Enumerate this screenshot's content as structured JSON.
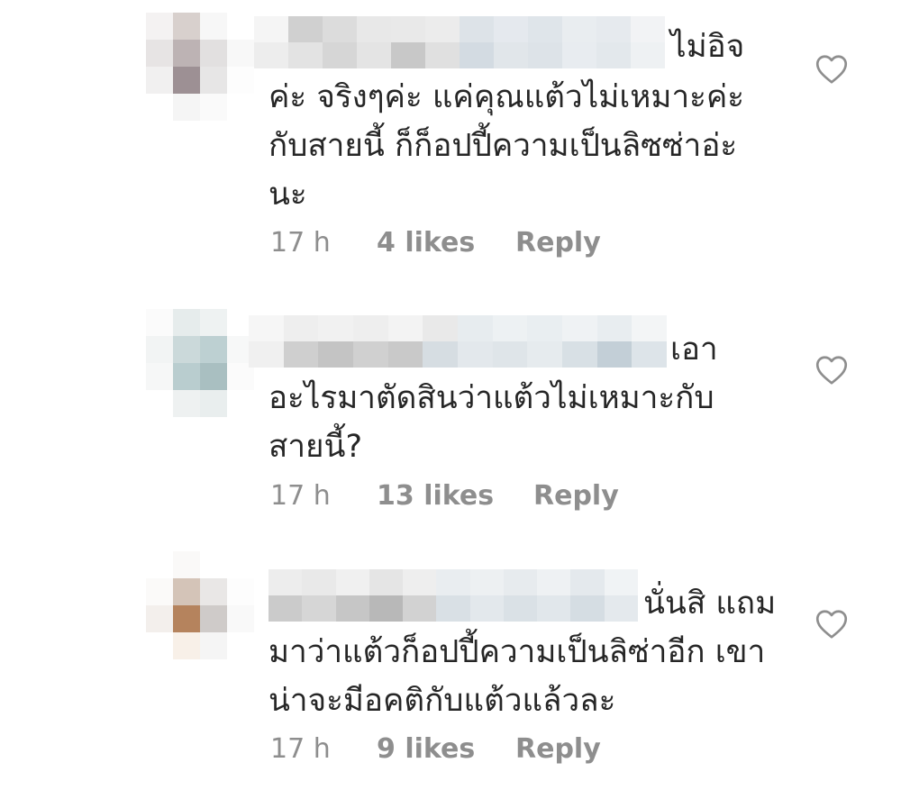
{
  "comments": [
    {
      "text_lines": [
        "ไม่อิจ",
        "ค่ะ จริงๆค่ะ แค่คุณแต้วไม่เหมาะค่ะ",
        "กับสายนี้ ก็ก็อปปี้ความเป็นลิซซ่าอ่ะ",
        "นะ"
      ],
      "time": "17 h",
      "likes": "4 likes",
      "reply": "Reply",
      "like_icon": "heart-outline-icon"
    },
    {
      "text_lines": [
        "เอา",
        "อะไรมาตัดสินว่าแต้วไม่เหมาะกับ",
        "สายนี้?"
      ],
      "time": "17 h",
      "likes": "13 likes",
      "reply": "Reply",
      "like_icon": "heart-outline-icon"
    },
    {
      "text_lines": [
        "นั่นสิ แถม",
        "มาว่าแต้วก็อปปี้ความเป็นลิซ่าอีก เขา",
        "น่าจะมีอคติกับแต้วแล้วละ"
      ],
      "time": "17 h",
      "likes": "9 likes",
      "reply": "Reply",
      "like_icon": "heart-outline-icon"
    }
  ],
  "colors": {
    "text": "#262626",
    "meta": "#8e8e8e",
    "heart_stroke": "#8e8e8e"
  }
}
